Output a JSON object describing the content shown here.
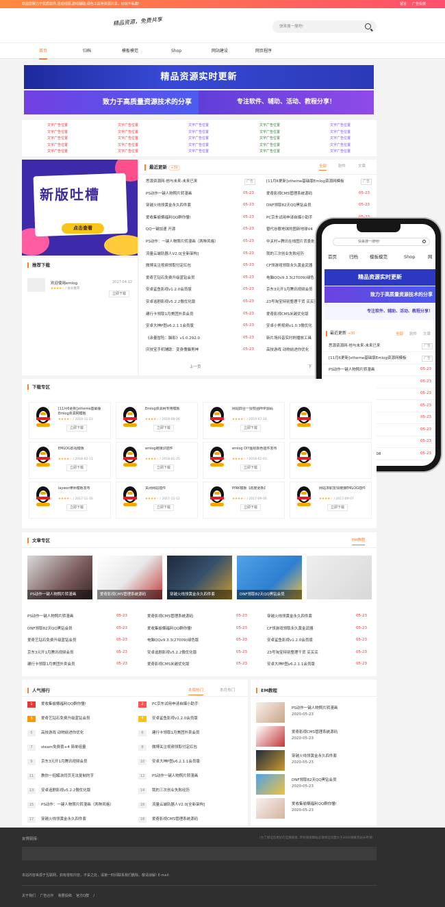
{
  "topbar": {
    "notice": "欢迎您致力于优质软件,活动线报,游戏辅助,绿色工具等资源共享，好玩不私藏!",
    "links": [
      "留言",
      "广告投放"
    ]
  },
  "header": {
    "slogan": "精品资源，免费共享",
    "search_placeholder": "快来搜一搜吧!"
  },
  "nav": [
    "首页",
    "归档",
    "模板模范",
    "Shop",
    "网站建设",
    "网页程序"
  ],
  "banners": {
    "title": "精品资源实时更新",
    "left": "致力于高质量资源技术的分享",
    "right": "专注软件、辅助、活动、教程分享！"
  },
  "ads": {
    "text": "文字广告位置",
    "colors": [
      "#e53935",
      "#e53935",
      "#7c4dff",
      "#2e7d32",
      "#7c4dff"
    ]
  },
  "promo": {
    "title": "新版吐槽",
    "button": "点击查看"
  },
  "recommend": {
    "title": "推荐下载",
    "item": {
      "name": "欢迎使用emlog",
      "date": "2017-04-12",
      "cat": "/ 站长推荐",
      "btn": "立即下载"
    }
  },
  "updates": {
    "title": "最近更新",
    "badge": "+30",
    "tabs": [
      "全部",
      "软件",
      "文章"
    ],
    "pagination": [
      "上一页",
      "下"
    ],
    "left": [
      {
        "t": "思源资源网-他与未来-未来已来",
        "tag": "广告"
      },
      {
        "t": "PS动作一键人物照片转漫画",
        "d": "05-23"
      },
      {
        "t": "穿越火线领黄金永久四件套",
        "d": "05-23"
      },
      {
        "t": "爱收集偷懒福利QQ群你懂!",
        "d": "05-23"
      },
      {
        "t": "QQ一键加速 开源",
        "d": "05-23"
      },
      {
        "t": "PS动作：一键人物照片转漫画（两种风格）",
        "d": "05-23"
      },
      {
        "t": "流量云端轨器人V2.0[全新架构]",
        "d": "05-23"
      },
      {
        "t": "微博关注视频领取付定红包",
        "d": "05-23"
      },
      {
        "t": "爱奇艺钻石免费升级蓝钻会员",
        "d": "05-23"
      },
      {
        "t": "安卓鲨鱼影视v1.2.0会员版",
        "d": "05-23"
      },
      {
        "t": "安卓追剧影视v5.2.2傲优化版",
        "d": "05-23"
      },
      {
        "t": "建行卡领取1月美团外卖会员",
        "d": "05-23"
      },
      {
        "t": "安卓大神P图v6.2.1.1会员版",
        "d": "05-23"
      },
      {
        "t": "《余量冒险：脑影》v1.0.292.0",
        "d": "05-23"
      },
      {
        "t": "庆技宝手机辅助：变身傀儡男神",
        "d": "05-23"
      }
    ],
    "right": [
      {
        "t": "[11月6更新]xtheme基础版Emlog资源网模板",
        "tag": "广告"
      },
      {
        "t": "爱奇影视CMS管理系统源码",
        "d": "05-23"
      },
      {
        "t": "DNF领取82天QQ黑钻会员",
        "d": "05-23"
      },
      {
        "t": "PC京东试用申请自爆小助手",
        "d": "05-23"
      },
      {
        "t": "替代谷歌地球的图新地球V4",
        "d": "05-23"
      },
      {
        "t": "中关村+腾讯在线图片背景处理",
        "d": "05-23"
      },
      {
        "t": "我的三次创业失败经历",
        "d": "05-23"
      },
      {
        "t": "CF领游戏领取永久黄金武器",
        "d": "05-23"
      },
      {
        "t": "电脑QQv9.3.3(27009)绿色",
        "d": "05-23"
      },
      {
        "t": "京东3元开1月腾讯视频会员",
        "d": "05-23"
      },
      {
        "t": "23号淘宝特别整理干货 买买买",
        "d": "05-23"
      },
      {
        "t": "爱奇影视CMS米越优化版",
        "d": "05-23"
      },
      {
        "t": "安卓小熊视频v1.0.3傲优化",
        "d": "05-23"
      },
      {
        "t": "新片场抖音实时刷播放工具",
        "d": "05-23"
      },
      {
        "t": "高技游戏 动物前进你优化",
        "d": "05-23"
      }
    ]
  },
  "phone": {
    "search": "快来搜一搜吧!",
    "nav": [
      "首页",
      "归档",
      "模板模范",
      "Shop",
      "网"
    ],
    "banner_title": "精品资源实时更新",
    "banner_left": "致力于高质量资源技术的分享",
    "banner_right": "专注软件、辅助、活动、教程分享！",
    "update_title": "最近更新",
    "badge": "+30",
    "tabs": [
      "全部",
      "软件",
      "文章"
    ],
    "rows": [
      {
        "t": "思源资源网-他与未来-未来已来",
        "tag": "广告"
      },
      {
        "t": "[11月6更新]xtheme基础版Emlog资源网模板",
        "tag": "广告"
      },
      {
        "t": "PS动作一键人物照片转漫画",
        "d": "05-23"
      },
      {
        "t": "爱奇影视CMS管理系统源码",
        "d": "05-23"
      },
      {
        "t": "穿越火线领黄金永久四件套",
        "d": "05-23"
      },
      {
        "t": "DNF领取82天QQ黑钻会员",
        "d": "05-23"
      },
      {
        "t": "爱收集偷懒福利QQ群你懂!",
        "d": "05-23"
      },
      {
        "t": "PC京东试用申请自爆小助手",
        "d": "05-23"
      },
      {
        "t": "QQ一键加速 开源",
        "d": "05-23"
      },
      {
        "t": "替代谷歌地球的图新地球V4.08",
        "d": "05-23"
      }
    ]
  },
  "downloads": {
    "title": "下载专区",
    "btn": "立即下载",
    "items": [
      {
        "t": "[11月6更新]xtheme基础版Emlog资源网模板",
        "s": "/ 2019-11-23"
      },
      {
        "t": "Emlog资源网专用模板",
        "s": "/ 2019-08-06"
      },
      {
        "t": "网站四合一授权函PHP源码",
        "s": "/ 2019-07-14"
      },
      {
        "t": "",
        "s": ""
      },
      {
        "t": "EMLOG影视模板",
        "s": "/ 2018-02-11"
      },
      {
        "t": "emlog链接识插件",
        "s": "/ 2018-01-25"
      },
      {
        "t": "emlog DIY图标颜色插件发布",
        "s": "/ 2018-01-01"
      },
      {
        "t": "",
        "s": ""
      },
      {
        "t": "laywer律师模板发布",
        "s": "/ 2017-11-16"
      },
      {
        "t": "关闭网站插件",
        "s": "/ 2017-11-12"
      },
      {
        "t": "PINK模板【再度更新】",
        "s": "/ 2017-09-06"
      },
      {
        "t": "网站求职友情链接EMLOG插件",
        "s": "/ 2017-09-07"
      }
    ]
  },
  "articles": {
    "title": "文章专区",
    "tab": "EM教程",
    "thumbs": [
      "PS动作一键人物照片转漫画",
      "爱奇影视CMS管理系统源码",
      "穿越火线领黄金永久四件套",
      "DNF领取82天QQ黑钻会员",
      ""
    ],
    "cols": [
      [
        {
          "t": "PS动作一键人物照片转漫画",
          "d": "05-23"
        },
        {
          "t": "DNF领取82天QQ黑钻会员",
          "d": "05-23"
        },
        {
          "t": "爱奇艺钻石免费升级蓝钻会员",
          "d": "05-23"
        },
        {
          "t": "京东3元开1月腾讯视频会员",
          "d": "05-23"
        },
        {
          "t": "建行卡领取1月美团外卖会员",
          "d": "05-23"
        }
      ],
      [
        {
          "t": "爱奇影视CMS管理系统源码",
          "d": "05-23"
        },
        {
          "t": "爱收集偷懒福利QQ群你懂!",
          "d": "05-23"
        },
        {
          "t": "电脑QQv9.3.3(27009)绿色版",
          "d": "05-23"
        },
        {
          "t": "安卓追剧影视v5.2.2傲优化版",
          "d": "05-23"
        },
        {
          "t": "爱奇影视CMS米越优化版",
          "d": "05-23"
        }
      ],
      [
        {
          "t": "穿越火线领黄金永久四件套",
          "d": "05-23"
        },
        {
          "t": "CF领游戏领取永久黄金武器",
          "d": "05-23"
        },
        {
          "t": "安卓鲨鱼影视v1.2.0会员版",
          "d": "05-23"
        },
        {
          "t": "23号淘宝特别整理干货 买买买",
          "d": "05-23"
        },
        {
          "t": "安卓大神P图v6.2.1.1会员版",
          "d": "05-23"
        }
      ]
    ]
  },
  "hot": {
    "title": "人气排行",
    "tabs": [
      "本周热门",
      "本月热门"
    ],
    "left": [
      {
        "n": "1",
        "t": "爱收集偷懒福利QQ群你懂!"
      },
      {
        "n": "3",
        "t": "爱奇艺钻石免费升级蓝钻会员"
      },
      {
        "n": "5",
        "t": "高技游戏 动物前进你优化"
      },
      {
        "n": "7",
        "t": "steam免费喜+4 简单组量"
      },
      {
        "n": "9",
        "t": "京东3元开1月腾讯视频会员"
      },
      {
        "n": "11",
        "t": "教你一招解决同页无法复制的字"
      },
      {
        "n": "13",
        "t": "安卓追剧影视v5.2.2傲优化版"
      },
      {
        "n": "15",
        "t": "PS动作：一键人物照片转漫画（两种风格）"
      },
      {
        "n": "17",
        "t": "穿越火线领黄金永久四件套"
      }
    ],
    "right": [
      {
        "n": "2",
        "t": "PC京东试用申请自爆小助手"
      },
      {
        "n": "4",
        "t": "安卓鲨鱼影视v1.2.0会员版"
      },
      {
        "n": "6",
        "t": "建行卡领取1月美团外卖会员"
      },
      {
        "n": "8",
        "t": "微博关注视频领取付定红包"
      },
      {
        "n": "10",
        "t": "安卓大神P图v6.2.1.1会员版"
      },
      {
        "n": "12",
        "t": "PS动作一键人物照片转漫画"
      },
      {
        "n": "14",
        "t": "我的三次创业失败经历"
      },
      {
        "n": "16",
        "t": "流量云端轨器人V2.0[全新架构]"
      },
      {
        "n": "18",
        "t": "爱奇影视CMS管理系统源码"
      }
    ]
  },
  "em": {
    "title": "EM教程",
    "items": [
      {
        "t": "PS动作一键人物照片转漫画",
        "d": "2020-05-23"
      },
      {
        "t": "爱奇影视CMS管理系统源码",
        "d": "2020-05-23"
      },
      {
        "t": "穿越火线领黄金永久四件套",
        "d": "2020-05-23"
      },
      {
        "t": "DNF领取82天QQ黑钻会员",
        "d": "2020-05-23"
      },
      {
        "t": "爱收集偷懒福利QQ群你懂!",
        "d": "2020-05-23"
      }
    ]
  },
  "footer": {
    "links_label": "友情链接:",
    "apply": "（为了保证您更好的互换链接, 所有链接网站必须保证流量大于3000请联系站长申请）",
    "notice": "本站内容来源于互联网，如有侵权内容，不妥之处，请第一时间联系我们删除。敬请谅解! E-mail:",
    "bottom": [
      "关于我们",
      "广告合作",
      "我要投稿",
      "官方Q群",
      "/"
    ]
  }
}
